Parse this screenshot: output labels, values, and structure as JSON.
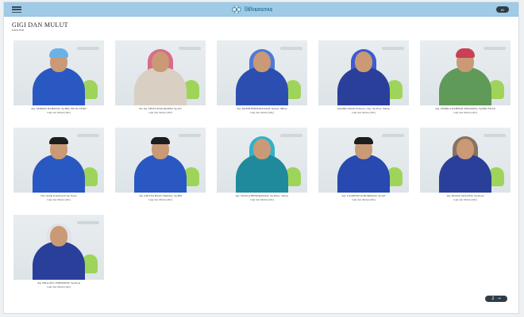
{
  "header": {
    "logo_small": "RSGM",
    "logo_big": "UNIVERSITAS",
    "lang": "ID",
    "next_page": "2",
    "next_arrow": "→"
  },
  "section": {
    "title": "GIGI DAN MULUT",
    "subtitle": "DOKTER"
  },
  "doctors": [
    {
      "name": "drg. ADRIAN RAHMAN, Sp.BM, FICOI, FISID",
      "role": "Gigi dan Mulut (OK)",
      "scrub": "#2a58c2",
      "headwear": "cap",
      "headwear_color": "#6ab2e6"
    },
    {
      "name": "Dr. drg. DEWI ANGGRAENI, Sp.Ort",
      "role": "Gigi dan Mulut (OK)",
      "scrub": "#d9cfc3",
      "headwear": "veil",
      "headwear_color": "#d96b8a"
    },
    {
      "name": "drg. RATIH PERMATASARI, Sp.KG, MKes",
      "role": "Gigi dan Mulut (OK)",
      "scrub": "#2c4eb0",
      "headwear": "veil",
      "headwear_color": "#4f79d8"
    },
    {
      "name": "Aufalhira Rusdi Prabowo, drg., Sp.Pros, Subsp.",
      "role": "Gigi dan Mulut (OK)",
      "scrub": "#2a3f9a",
      "headwear": "veil",
      "headwear_color": "#3e5bd2"
    },
    {
      "name": "drg. ANDIKA RAHMAT PRATAMA, Sp.BM, FICOI",
      "role": "Gigi dan Mulut (OK)",
      "scrub": "#5f9a58",
      "headwear": "cap",
      "headwear_color": "#c94154"
    },
    {
      "name": "Dra. Indah Kurniawati Sp. Perio",
      "role": "Gigi dan Mulut (OK)",
      "scrub": "#2a58c2",
      "headwear": "none",
      "headwear_color": "#1d1d1d"
    },
    {
      "name": "drg. ADITYA BAYU HARSA, Sp.BM",
      "role": "Gigi dan Mulut (OK)",
      "scrub": "#2a58c2",
      "headwear": "none",
      "headwear_color": "#1d1d1d"
    },
    {
      "name": "drg. SUSILA HENDRAWATI, Sp.Perio, Subsp.",
      "role": "Gigi dan Mulut (OK)",
      "scrub": "#1f8a9c",
      "headwear": "veil",
      "headwear_color": "#2fb3c9"
    },
    {
      "name": "drg. LAURENCIA BUDIMAN, Sp.Ort",
      "role": "Gigi dan Mulut (OK)",
      "scrub": "#2849b0",
      "headwear": "none",
      "headwear_color": "#1d1d1d"
    },
    {
      "name": "drg. RIANA SUSANTI, Sp.KGA",
      "role": "Gigi dan Mulut (OK)",
      "scrub": "#2a3f9a",
      "headwear": "veil",
      "headwear_color": "#8a7260"
    },
    {
      "name": "drg. FIRA AYU WIBISONO, Sp.KGA",
      "role": "Gigi dan Mulut (OK)",
      "scrub": "#2a3f9a",
      "headwear": "veil",
      "headwear_color": "#e2e2e8"
    }
  ],
  "colors": {
    "topbar": "#9fcbe6",
    "accent": "#1f6f94",
    "dark_pill": "#2f3d48"
  }
}
